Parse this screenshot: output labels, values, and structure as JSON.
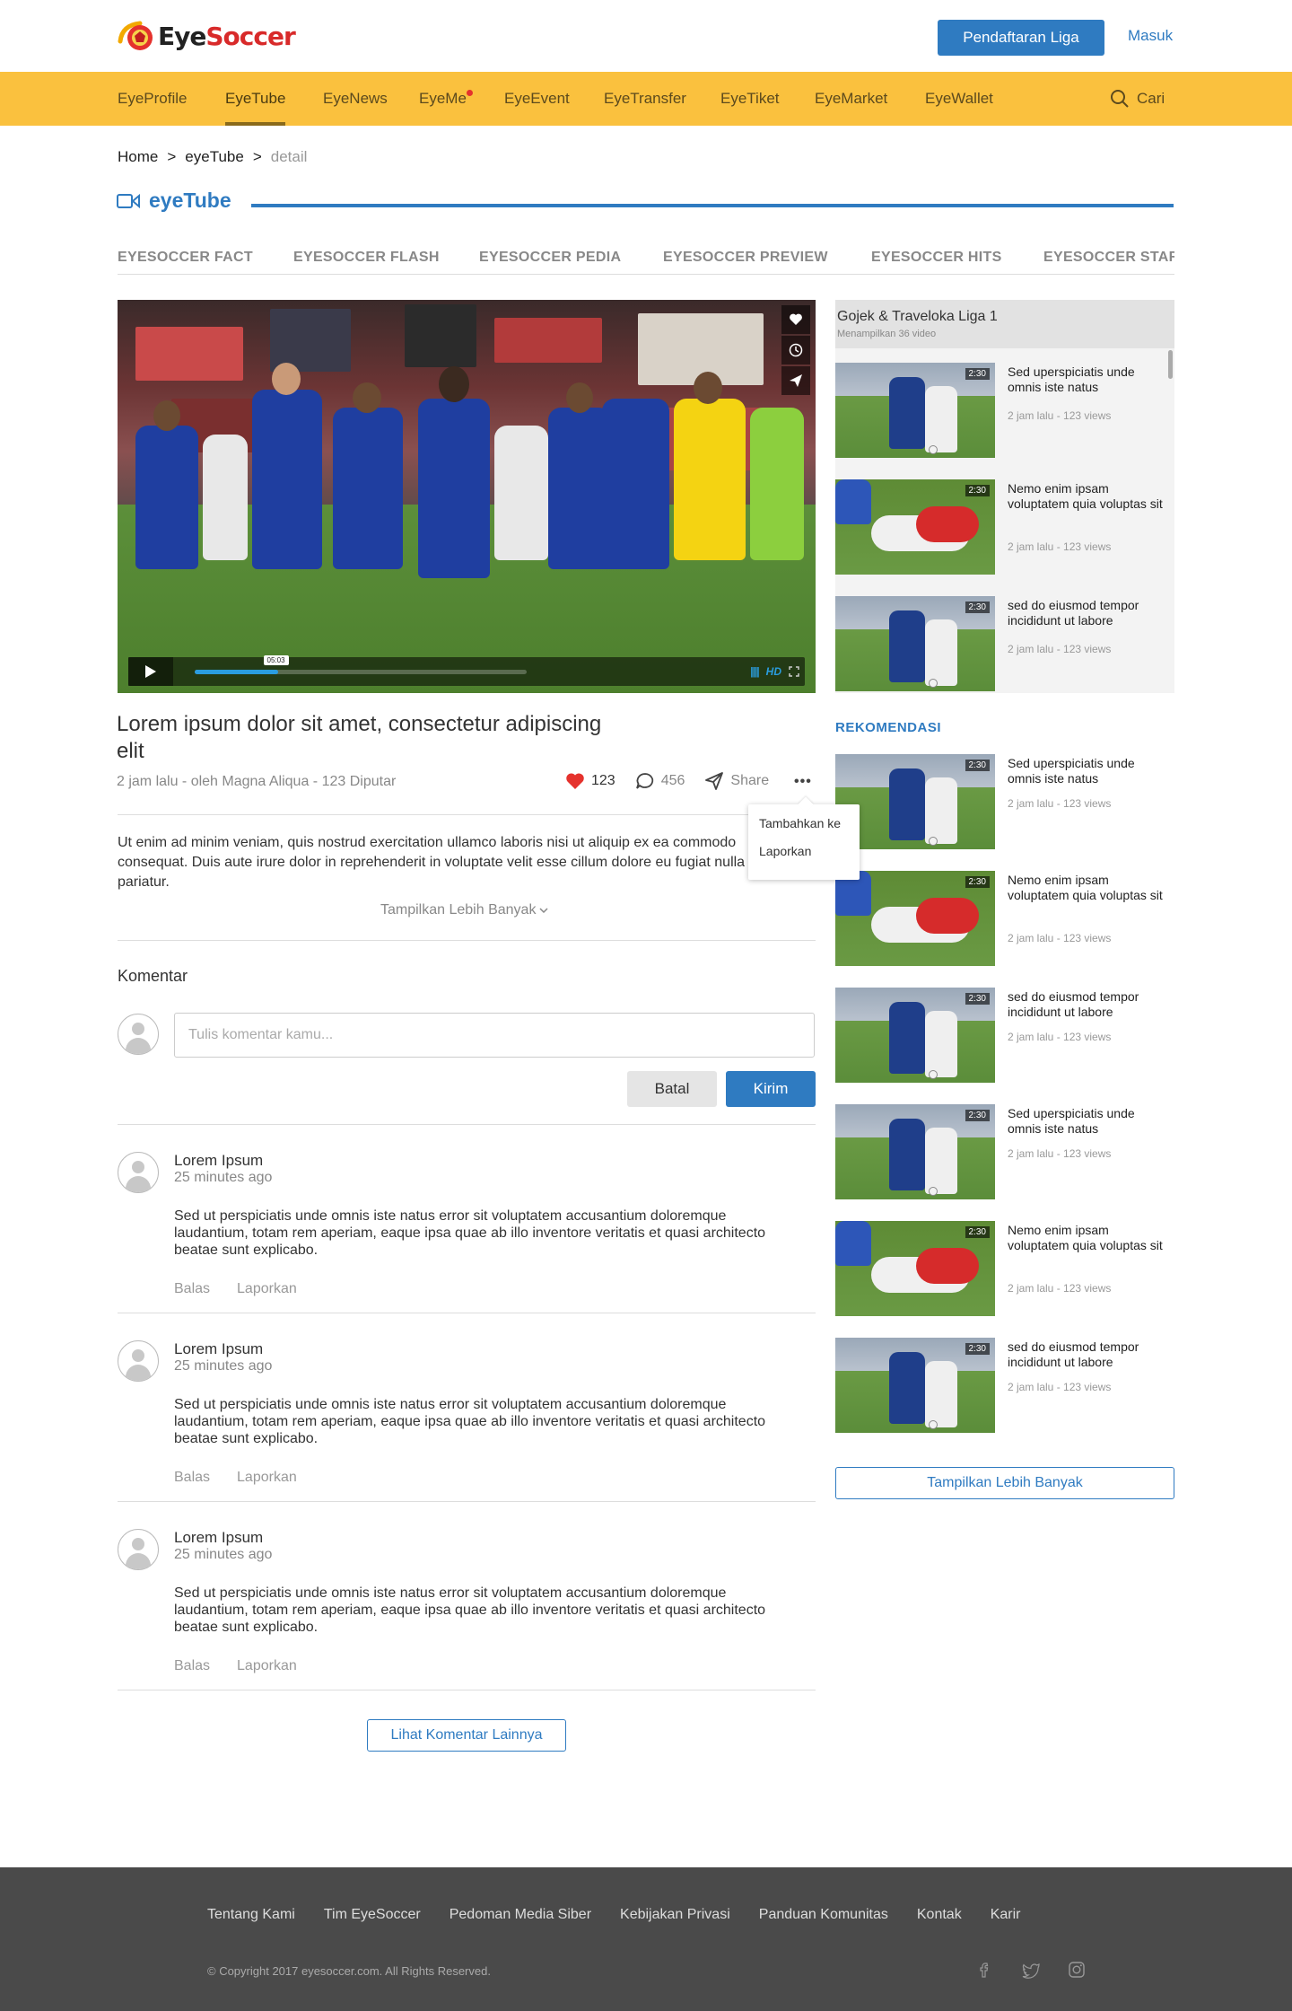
{
  "header": {
    "logo_prefix": "Eye",
    "logo_suffix": "Soccer",
    "register_label": "Pendaftaran Liga",
    "login_label": "Masuk"
  },
  "nav": {
    "items": [
      "EyeProfile",
      "EyeTube",
      "EyeNews",
      "EyeMe",
      "EyeEvent",
      "EyeTransfer",
      "EyeTiket",
      "EyeMarket",
      "EyeWallet"
    ],
    "active": "EyeTube",
    "search_label": "Cari"
  },
  "breadcrumb": {
    "home": "Home",
    "sep": ">",
    "section": "eyeTube",
    "current": "detail"
  },
  "section": {
    "title": "eyeTube"
  },
  "categories": [
    "EYESOCCER FACT",
    "EYESOCCER FLASH",
    "EYESOCCER PEDIA",
    "EYESOCCER PREVIEW",
    "EYESOCCER HITS",
    "EYESOCCER STAR"
  ],
  "player": {
    "tooltip_time": "05:03",
    "quality": "HD",
    "progress": 0.25
  },
  "playlist": {
    "title": "Gojek & Traveloka Liga 1",
    "subtitle": "Menampilkan 36 video",
    "items": [
      {
        "title": "Sed uperspiciatis unde omnis iste natus",
        "meta": "2 jam lalu - 123 views",
        "duration": "2:30"
      },
      {
        "title": "Nemo enim ipsam voluptatem quia voluptas sit",
        "meta": "2 jam lalu - 123 views",
        "duration": "2:30"
      },
      {
        "title": "sed do eiusmod tempor incididunt ut labore",
        "meta": "2 jam lalu - 123 views",
        "duration": "2:30"
      }
    ]
  },
  "recommend": {
    "title": "REKOMENDASI",
    "items": [
      {
        "title": "Sed uperspiciatis unde omnis iste natus",
        "meta": "2 jam lalu - 123 views",
        "duration": "2:30"
      },
      {
        "title": "Nemo enim ipsam voluptatem quia voluptas sit",
        "meta": "2 jam lalu - 123 views",
        "duration": "2:30"
      },
      {
        "title": "sed do eiusmod tempor incididunt ut labore",
        "meta": "2 jam lalu - 123 views",
        "duration": "2:30"
      },
      {
        "title": "Sed uperspiciatis unde omnis iste natus",
        "meta": "2 jam lalu - 123 views",
        "duration": "2:30"
      },
      {
        "title": "Nemo enim ipsam voluptatem quia voluptas sit",
        "meta": "2 jam lalu - 123 views",
        "duration": "2:30"
      },
      {
        "title": "sed do eiusmod tempor incididunt ut labore",
        "meta": "2 jam lalu - 123 views",
        "duration": "2:30"
      }
    ],
    "more_label": "Tampilkan Lebih Banyak"
  },
  "video": {
    "title": "Lorem ipsum dolor sit amet, consectetur adipiscing elit",
    "meta": "2 jam lalu - oleh Magna Aliqua - 123 Diputar",
    "likes": "123",
    "comments": "456",
    "share_label": "Share",
    "more_dots": "•••",
    "menu": [
      "Tambahkan ke",
      "Laporkan"
    ],
    "description": "Ut enim ad minim veniam, quis nostrud exercitation ullamco laboris nisi ut aliquip ex ea commodo consequat. Duis aute irure dolor in reprehenderit in voluptate velit esse cillum dolore eu fugiat nulla pariatur.",
    "show_more": "Tampilkan Lebih Banyak"
  },
  "comments": {
    "heading": "Komentar",
    "placeholder": "Tulis komentar kamu...",
    "cancel_label": "Batal",
    "send_label": "Kirim",
    "items": [
      {
        "name": "Lorem Ipsum",
        "time": "25 minutes ago",
        "text": "Sed ut perspiciatis unde omnis iste natus error sit voluptatem accusantium doloremque laudantium, totam rem aperiam, eaque ipsa quae ab illo inventore veritatis et quasi architecto beatae sunt explicabo.",
        "reply": "Balas",
        "report": "Laporkan"
      },
      {
        "name": "Lorem Ipsum",
        "time": "25 minutes ago",
        "text": "Sed ut perspiciatis unde omnis iste natus error sit voluptatem accusantium doloremque laudantium, totam rem aperiam, eaque ipsa quae ab illo inventore veritatis et quasi architecto beatae sunt explicabo.",
        "reply": "Balas",
        "report": "Laporkan"
      },
      {
        "name": "Lorem Ipsum",
        "time": "25 minutes ago",
        "text": "Sed ut perspiciatis unde omnis iste natus error sit voluptatem accusantium doloremque laudantium, totam rem aperiam, eaque ipsa quae ab illo inventore veritatis et quasi architecto beatae sunt explicabo.",
        "reply": "Balas",
        "report": "Laporkan"
      }
    ],
    "more_label": "Lihat Komentar Lainnya"
  },
  "footer": {
    "links": [
      "Tentang Kami",
      "Tim EyeSoccer",
      "Pedoman Media Siber",
      "Kebijakan Privasi",
      "Panduan Komunitas",
      "Kontak",
      "Karir"
    ],
    "copyright": "© Copyright 2017 eyesoccer.com. All Rights Reserved.",
    "social": [
      "facebook-icon",
      "twitter-icon",
      "instagram-icon"
    ]
  },
  "colors": {
    "brand_blue": "#2f7bc1",
    "nav_yellow": "#fac13e",
    "footer_bg": "#4a4a4a",
    "like_red": "#e5322d"
  }
}
